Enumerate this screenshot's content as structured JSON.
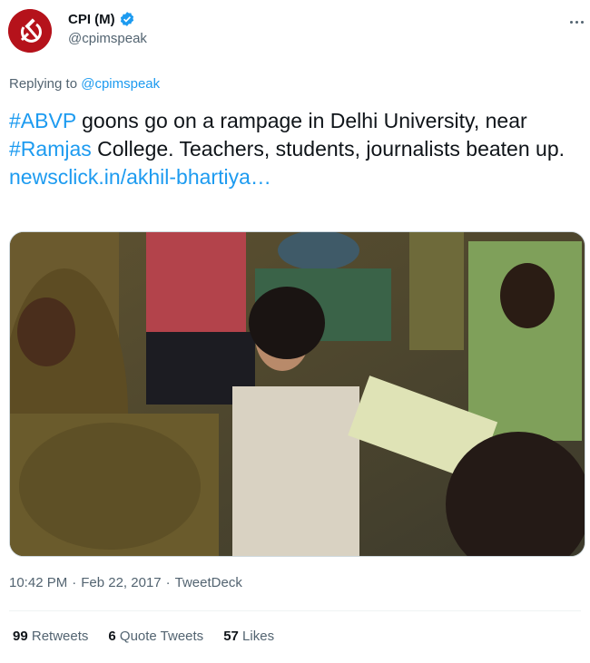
{
  "author": {
    "display_name": "CPI (M)",
    "handle": "@cpimspeak",
    "avatar_icon": "hammer-sickle-icon",
    "verified": true
  },
  "reply": {
    "prefix": "Replying to",
    "mention": "@cpimspeak"
  },
  "tweet": {
    "hashtag_1": "#ABVP",
    "text_1": " goons go on a rampage in Delhi University, near ",
    "hashtag_2": "#Ramjas",
    "text_2": " College. Teachers, students, journalists beaten up.",
    "link": "newsclick.in/akhil-bhartiya…"
  },
  "meta": {
    "time": "10:42 PM",
    "sep1": "·",
    "date": "Feb 22, 2017",
    "sep2": "·",
    "source": "TweetDeck"
  },
  "stats": {
    "retweets_count": "99",
    "retweets_label": "Retweets",
    "quotes_count": "6",
    "quotes_label": "Quote Tweets",
    "likes_count": "57",
    "likes_label": "Likes"
  },
  "colors": {
    "accent": "#1d9bf0",
    "avatar_bg": "#b5121b",
    "muted": "#536471"
  }
}
